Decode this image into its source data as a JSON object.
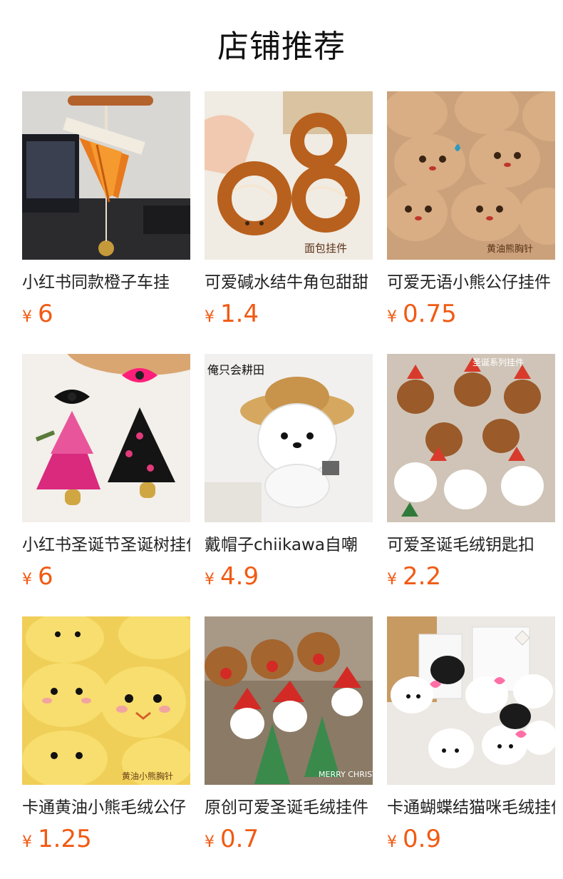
{
  "page": {
    "title": "店铺推荐"
  },
  "products": [
    {
      "name": "小红书同款橙子车挂",
      "currency": "¥",
      "price": "6"
    },
    {
      "name": "可爱碱水结牛角包甜甜",
      "currency": "¥",
      "price": "1.4"
    },
    {
      "name": "可爱无语小熊公仔挂件",
      "currency": "¥",
      "price": "0.75"
    },
    {
      "name": "小红书圣诞节圣诞树挂件",
      "currency": "¥",
      "price": "6"
    },
    {
      "name": "戴帽子chiikawa自嘲",
      "currency": "¥",
      "price": "4.9"
    },
    {
      "name": "可爱圣诞毛绒钥匙扣",
      "currency": "¥",
      "price": "2.2"
    },
    {
      "name": "卡通黄油小熊毛绒公仔",
      "currency": "¥",
      "price": "1.25"
    },
    {
      "name": "原创可爱圣诞毛绒挂件",
      "currency": "¥",
      "price": "0.7"
    },
    {
      "name": "卡通蝴蝶结猫咪毛绒挂件",
      "currency": "¥",
      "price": "0.9"
    }
  ],
  "images": [
    {
      "icon": "orange-car-charm-photo",
      "caption": ""
    },
    {
      "icon": "pretzel-charm-photo",
      "caption": "面包挂件"
    },
    {
      "icon": "brown-bear-plush-photo",
      "caption": "黄油熊胸针"
    },
    {
      "icon": "christmas-tree-charm-photo",
      "caption": ""
    },
    {
      "icon": "white-bear-straw-hat-photo",
      "caption": "俺只会耕田"
    },
    {
      "icon": "christmas-plush-keychain-photo",
      "caption": "圣诞系列挂件"
    },
    {
      "icon": "yellow-bear-plush-photo",
      "caption": "黄油小熊胸针"
    },
    {
      "icon": "reindeer-santa-plush-photo",
      "caption": "MERRY CHRISTMAS"
    },
    {
      "icon": "bow-cat-plush-photo",
      "caption": ""
    }
  ]
}
